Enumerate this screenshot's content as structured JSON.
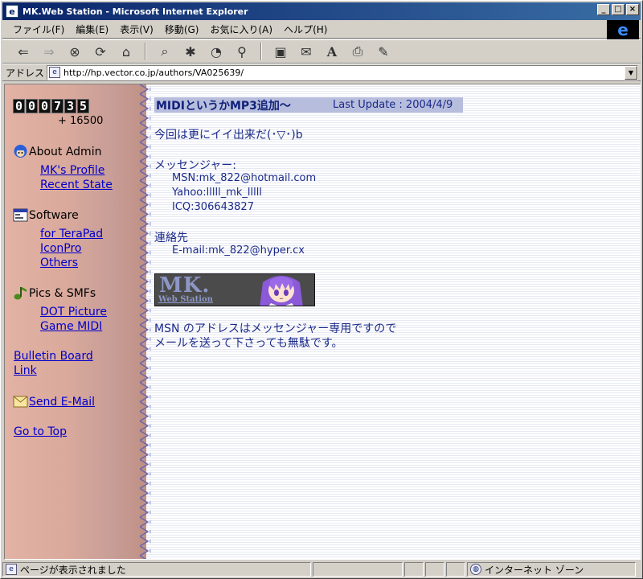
{
  "window": {
    "title": "MK.Web Station - Microsoft Internet Explorer",
    "minimize": "_",
    "maximize": "□",
    "close": "×"
  },
  "menu": [
    "ファイル(F)",
    "編集(E)",
    "表示(V)",
    "移動(G)",
    "お気に入り(A)",
    "ヘルプ(H)"
  ],
  "toolbar": {
    "icons": [
      "back-icon",
      "forward-icon",
      "stop-icon",
      "refresh-icon",
      "home-icon",
      "search-icon",
      "favorites-icon",
      "history-icon",
      "channels-icon",
      "fullscreen-icon",
      "mail-icon",
      "font-icon",
      "print-icon",
      "edit-icon"
    ]
  },
  "address": {
    "label": "アドレス",
    "url": "http://hp.vector.co.jp/authors/VA025639/"
  },
  "sidebar": {
    "counter": "000735",
    "counter_extra": "+ 16500",
    "sections": [
      {
        "title": "About Admin",
        "icon": "admin-avatar-icon",
        "links": [
          "MK's Profile",
          "Recent State"
        ]
      },
      {
        "title": "Software",
        "icon": "window-icon",
        "links": [
          "for TeraPad",
          "IconPro",
          "Others"
        ]
      },
      {
        "title": "Pics & SMFs",
        "icon": "music-note-icon",
        "links": [
          "DOT Picture",
          "Game MIDI"
        ]
      }
    ],
    "bulletin": "Bulletin Board",
    "link": "Link",
    "send_mail": "Send E-Mail",
    "go_top": "Go to Top"
  },
  "main": {
    "header_title": "MIDIというかMP3追加〜",
    "last_update": "Last Update : 2004/4/9",
    "intro": "今回は更にイイ出来だ(･▽･)b",
    "messenger_label": "メッセンジャー:",
    "msn": "MSN:mk_822@hotmail.com",
    "yahoo": "Yahoo:lllll_mk_lllll",
    "icq": "ICQ:306643827",
    "contact_label": "連絡先",
    "email": "E-mail:mk_822@hyper.cx",
    "banner_title": "MK.",
    "banner_sub": "Web Station",
    "note1": "MSN のアドレスはメッセンジャー専用ですので",
    "note2": "メールを送って下さっても無駄です。"
  },
  "status": {
    "text": "ページが表示されました",
    "zone": "インターネット ゾーン"
  },
  "colors": {
    "title_bar": "#0a246a",
    "link": "#0000cc",
    "main_text": "#1a2a8a",
    "header_bg": "#b7bddc"
  }
}
